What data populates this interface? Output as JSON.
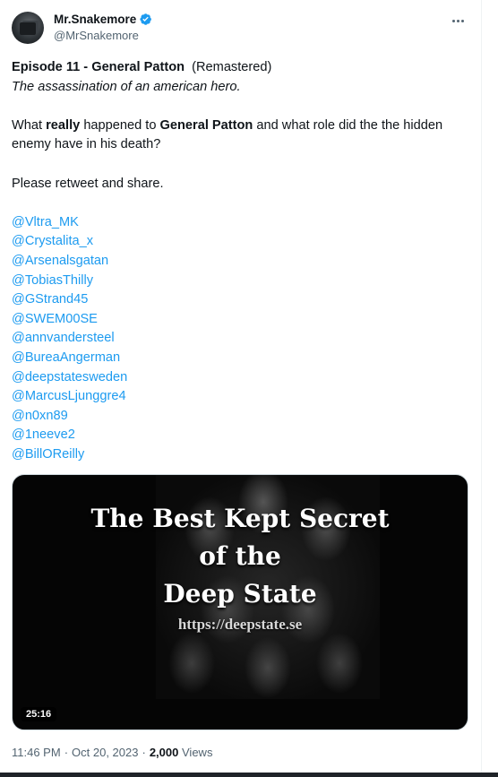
{
  "author": {
    "display_name": "Mr.Snakemore",
    "handle": "@MrSnakemore",
    "verified_color": "#1d9bf0"
  },
  "tweet": {
    "title_bold": "Episode 11 - General Patton",
    "title_rest": "(Remastered)",
    "subtitle": "The assassination of an american hero.",
    "question": {
      "p1": "What ",
      "p2": "really",
      "p3": " happened to ",
      "p4": "General Patton",
      "p5": " and what role did the the hidden enemy have in his death?"
    },
    "cta": "Please retweet and share.",
    "mentions": [
      "@Vltra_MK",
      "@Crystalita_x",
      "@Arsenalsgatan",
      "@TobiasThilly",
      "@GStrand45",
      "@SWEM00SE",
      "@annvandersteel",
      "@BureaAngerman",
      "@deepstatesweden",
      "@MarcusLjunggre4",
      "@n0xn89",
      "@1neeve2",
      "@BillOReilly"
    ]
  },
  "video": {
    "title_lines": [
      "The Best Kept Secret",
      "of the",
      "Deep State"
    ],
    "url": "https://deepstate.se",
    "duration": "25:16"
  },
  "meta": {
    "time": "11:46 PM",
    "sep1": "·",
    "date": "Oct 20, 2023",
    "sep2": "·",
    "views_count": "2,000",
    "views_label": "Views"
  },
  "icons": {
    "verified": "verified-badge-icon",
    "more": "more-dots-icon"
  }
}
